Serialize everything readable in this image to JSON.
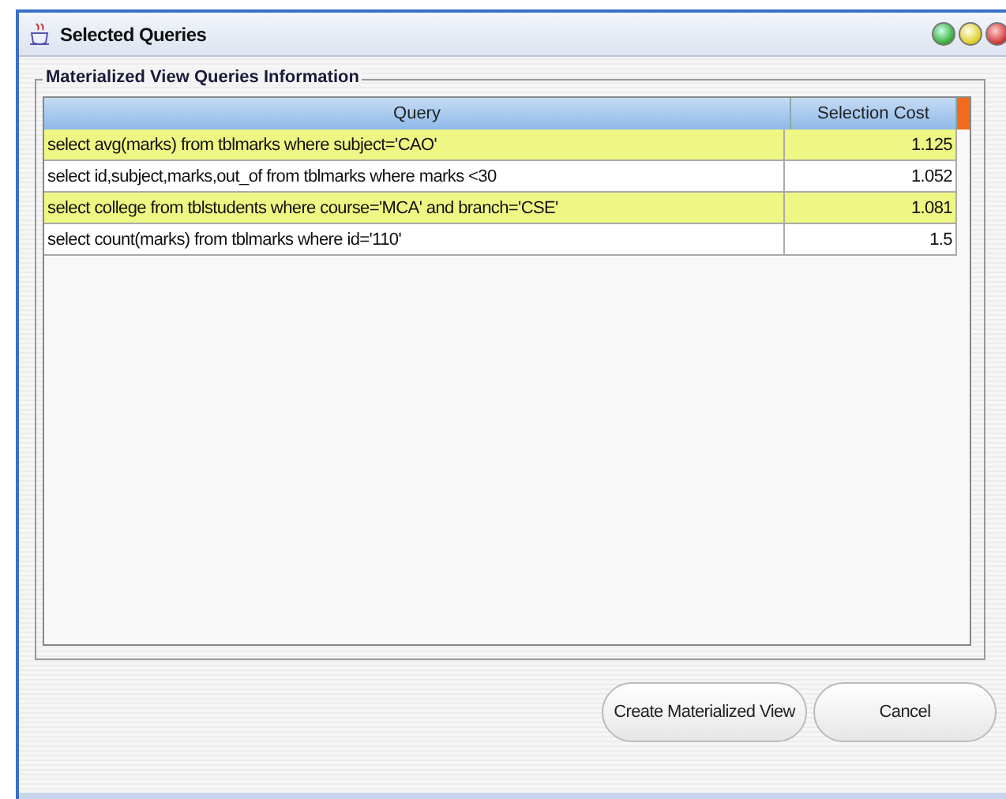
{
  "window": {
    "title": "Selected Queries"
  },
  "panel": {
    "title": "Materialized View Queries Information"
  },
  "table": {
    "columns": [
      "Query",
      "Selection Cost"
    ],
    "rows": [
      {
        "cells": [
          "select avg(marks) from tblmarks where subject='CAO'",
          "1.125"
        ],
        "selected": true
      },
      {
        "cells": [
          "select id,subject,marks,out_of from tblmarks where marks <30",
          "1.052"
        ],
        "selected": false
      },
      {
        "cells": [
          "select college from tblstudents where course='MCA' and branch='CSE'",
          "1.081"
        ],
        "selected": true
      },
      {
        "cells": [
          "select count(marks) from tblmarks where id='110'",
          "1.5"
        ],
        "selected": false
      }
    ]
  },
  "buttons": [
    "Create Materialized View",
    "Cancel"
  ]
}
